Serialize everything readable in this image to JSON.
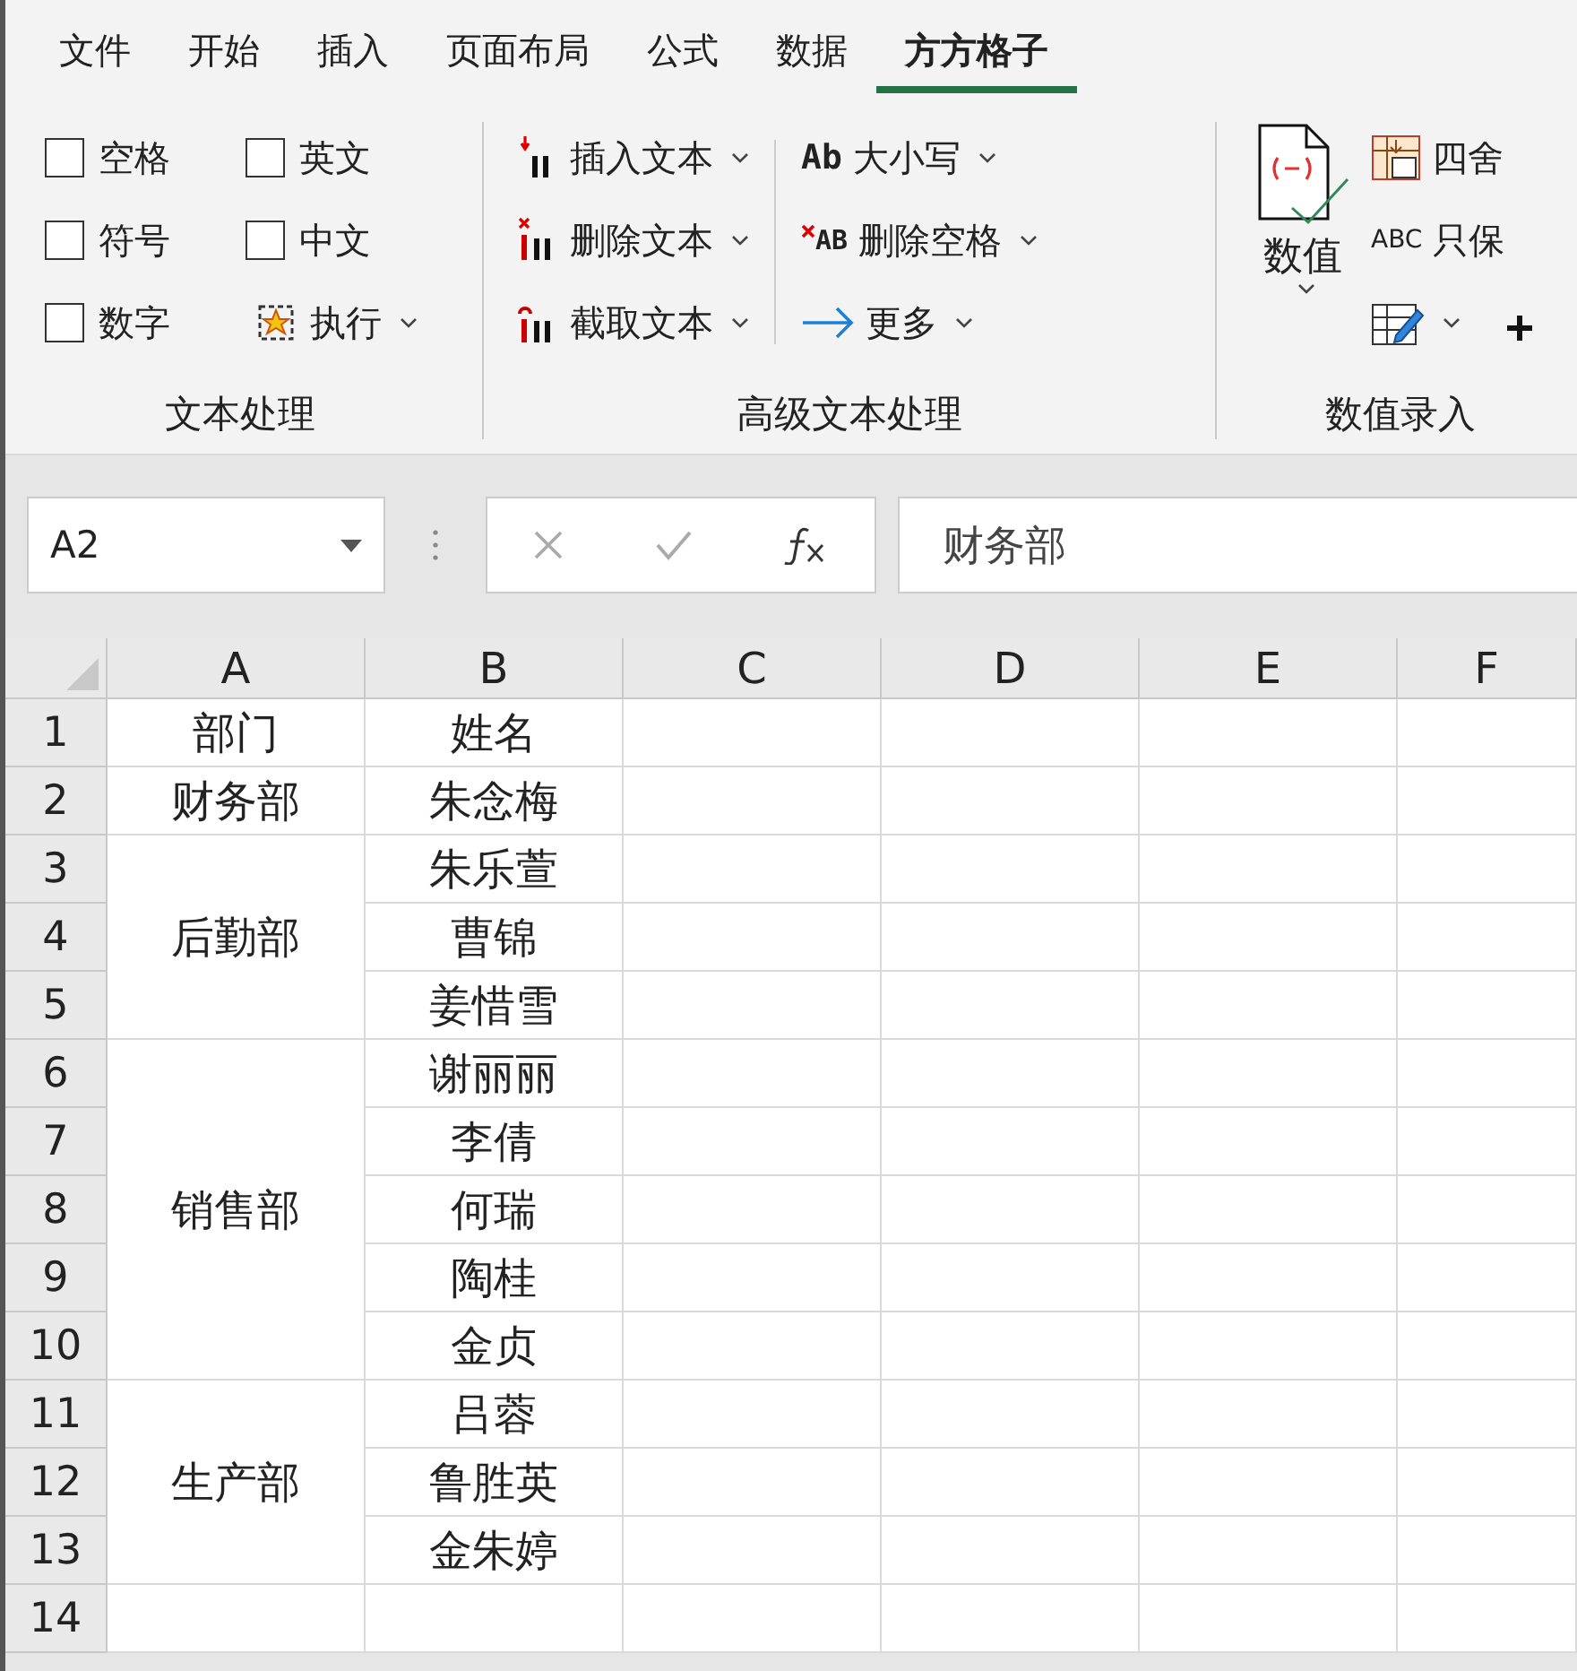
{
  "tabs": [
    {
      "label": "文件",
      "selected": false
    },
    {
      "label": "开始",
      "selected": false
    },
    {
      "label": "插入",
      "selected": false
    },
    {
      "label": "页面布局",
      "selected": false
    },
    {
      "label": "公式",
      "selected": false
    },
    {
      "label": "数据",
      "selected": false
    },
    {
      "label": "方方格子",
      "selected": true
    }
  ],
  "ribbon": {
    "text_group": {
      "title": "文本处理",
      "options": [
        {
          "label": "空格",
          "checked": false
        },
        {
          "label": "英文",
          "checked": false
        },
        {
          "label": "符号",
          "checked": false
        },
        {
          "label": "中文",
          "checked": false
        },
        {
          "label": "数字",
          "checked": false
        }
      ],
      "run_button": "执行"
    },
    "advanced_group": {
      "title": "高级文本处理",
      "buttons": [
        {
          "label": "插入文本",
          "kind": "insert"
        },
        {
          "label": "大小写",
          "kind": "case",
          "icon_text": "Ab"
        },
        {
          "label": "删除文本",
          "kind": "delete"
        },
        {
          "label": "删除空格",
          "kind": "despace",
          "icon_text": "AB"
        },
        {
          "label": "截取文本",
          "kind": "extract"
        },
        {
          "label": "更多",
          "kind": "more"
        }
      ]
    },
    "number_group": {
      "title": "数值录入",
      "big_button": "数值",
      "buttons": [
        "四舍",
        "只保"
      ],
      "keep_icon_text": "ABC"
    }
  },
  "formula_bar": {
    "name_box": "A2",
    "value": "财务部"
  },
  "sheet": {
    "columns": [
      "A",
      "B",
      "C",
      "D",
      "E",
      "F"
    ],
    "header_row": {
      "number": "1",
      "department": "部门",
      "name": "姓名"
    },
    "groups": [
      {
        "department": "财务部",
        "rows": [
          {
            "number": "2",
            "name": "朱念梅"
          }
        ]
      },
      {
        "department": "后勤部",
        "rows": [
          {
            "number": "3",
            "name": "朱乐萱"
          },
          {
            "number": "4",
            "name": "曹锦"
          },
          {
            "number": "5",
            "name": "姜惜雪"
          }
        ]
      },
      {
        "department": "销售部",
        "rows": [
          {
            "number": "6",
            "name": "谢丽丽"
          },
          {
            "number": "7",
            "name": "李倩"
          },
          {
            "number": "8",
            "name": "何瑞"
          },
          {
            "number": "9",
            "name": "陶桂"
          },
          {
            "number": "10",
            "name": "金贞"
          }
        ]
      },
      {
        "department": "生产部",
        "rows": [
          {
            "number": "11",
            "name": "吕蓉"
          },
          {
            "number": "12",
            "name": "鲁胜英"
          },
          {
            "number": "13",
            "name": "金朱婷"
          }
        ]
      }
    ],
    "empty_rows": [
      "14"
    ]
  }
}
